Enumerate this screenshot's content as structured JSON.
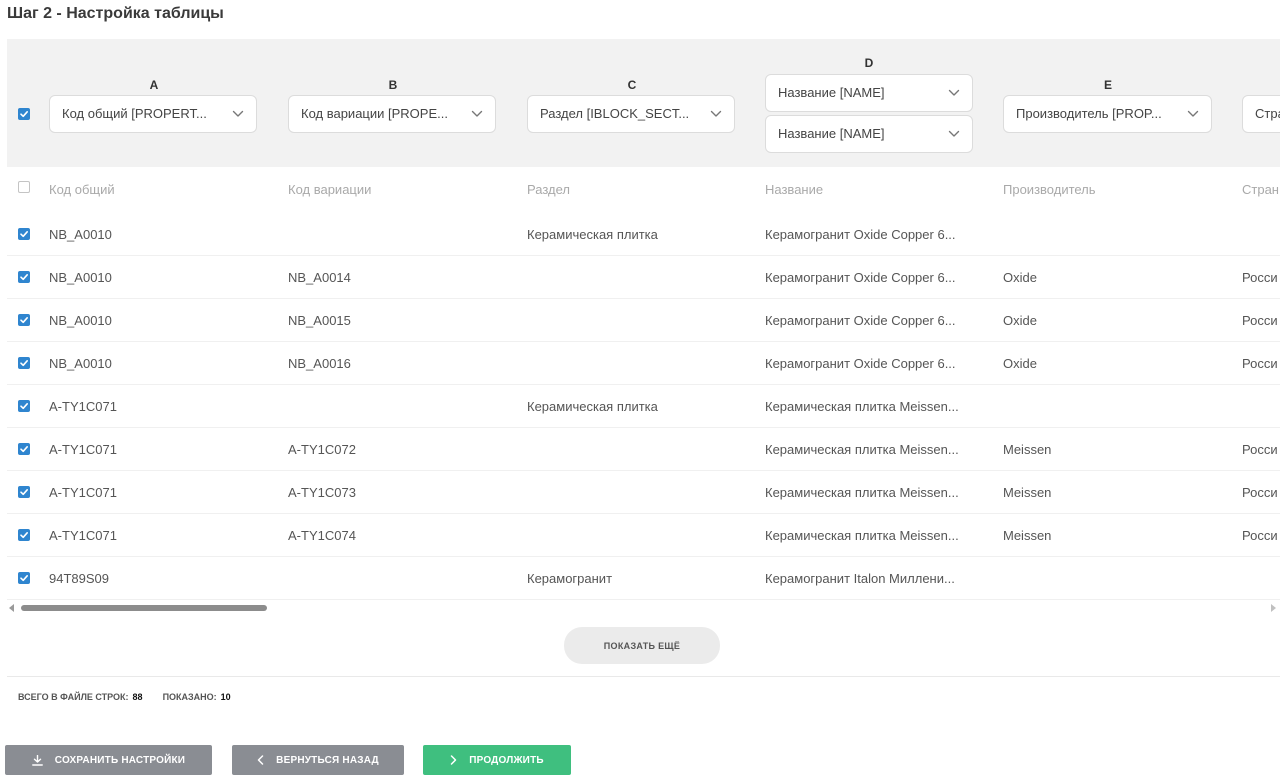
{
  "page": {
    "title": "Шаг 2 - Настройка таблицы"
  },
  "columns": [
    {
      "letter": "A",
      "selects": [
        "Код общий [PROPERT..."
      ],
      "header": "Код общий"
    },
    {
      "letter": "B",
      "selects": [
        "Код вариации [PROPE..."
      ],
      "header": "Код вариации"
    },
    {
      "letter": "C",
      "selects": [
        "Раздел [IBLOCK_SECT..."
      ],
      "header": "Раздел"
    },
    {
      "letter": "D",
      "selects": [
        "Название [NAME]",
        "Название [NAME]"
      ],
      "header": "Название"
    },
    {
      "letter": "E",
      "selects": [
        "Производитель [PROP..."
      ],
      "header": "Производитель"
    },
    {
      "letter": "",
      "selects": [
        "Стра"
      ],
      "header": "Стран"
    }
  ],
  "rows": [
    {
      "checked": true,
      "cells": [
        "NB_A0010",
        "",
        "Керамическая плитка",
        "Керамогранит Oxide Copper 6...",
        "",
        ""
      ]
    },
    {
      "checked": true,
      "cells": [
        "NB_A0010",
        "NB_A0014",
        "",
        "Керамогранит Oxide Copper 6...",
        "Oxide",
        "Росси"
      ]
    },
    {
      "checked": true,
      "cells": [
        "NB_A0010",
        "NB_A0015",
        "",
        "Керамогранит Oxide Copper 6...",
        "Oxide",
        "Росси"
      ]
    },
    {
      "checked": true,
      "cells": [
        "NB_A0010",
        "NB_A0016",
        "",
        "Керамогранит Oxide Copper 6...",
        "Oxide",
        "Росси"
      ]
    },
    {
      "checked": true,
      "cells": [
        "A-TY1C071",
        "",
        "Керамическая плитка",
        "Керамическая плитка Meissen...",
        "",
        ""
      ]
    },
    {
      "checked": true,
      "cells": [
        "A-TY1C071",
        "A-TY1C072",
        "",
        "Керамическая плитка Meissen...",
        "Meissen",
        "Росси"
      ]
    },
    {
      "checked": true,
      "cells": [
        "A-TY1C071",
        "A-TY1C073",
        "",
        "Керамическая плитка Meissen...",
        "Meissen",
        "Росси"
      ]
    },
    {
      "checked": true,
      "cells": [
        "A-TY1C071",
        "A-TY1C074",
        "",
        "Керамическая плитка Meissen...",
        "Meissen",
        "Росси"
      ]
    },
    {
      "checked": true,
      "cells": [
        "94T89S09",
        "",
        "Керамогранит",
        "Керамогранит Italon Миллени...",
        "",
        ""
      ]
    }
  ],
  "show_more": {
    "label": "ПОКАЗАТЬ ЕЩЁ"
  },
  "stats": {
    "total_label": "ВСЕГО В ФАЙЛЕ СТРОК:",
    "total_value": "88",
    "shown_label": "ПОКАЗАНО:",
    "shown_value": "10"
  },
  "buttons": {
    "save": "СОХРАНИТЬ НАСТРОЙКИ",
    "back": "ВЕРНУТЬСЯ НАЗАД",
    "next": "ПРОДОЛЖИТЬ"
  },
  "icons": {
    "save": "download-icon",
    "back": "chevron-left-icon",
    "next": "chevron-right-icon",
    "select": "chevron-down-icon",
    "checkbox": "checkmark-icon"
  },
  "colors": {
    "accent": "#2f85cf",
    "success": "#3fbf7f",
    "neutral_button": "#8a8d93",
    "header_band": "#f2f2f2"
  }
}
